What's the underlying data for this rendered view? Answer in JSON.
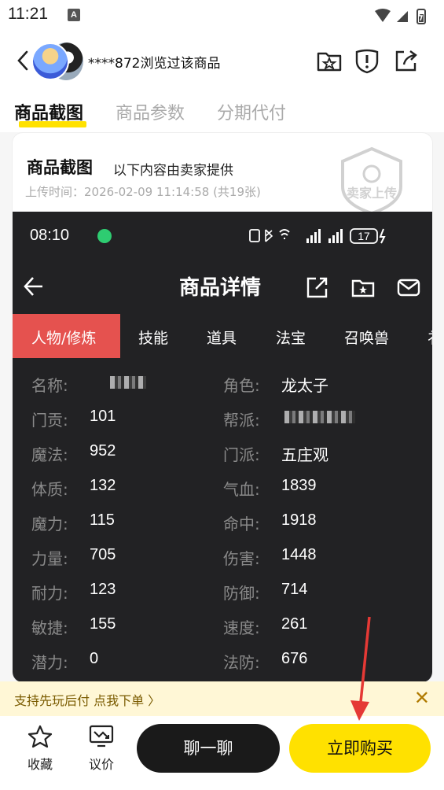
{
  "status": {
    "time": "11:21",
    "app_icon": "A"
  },
  "header": {
    "browse_text": "****872浏览过该商品"
  },
  "tabs": [
    {
      "label": "商品截图"
    },
    {
      "label": "商品参数"
    },
    {
      "label": "分期代付"
    }
  ],
  "card": {
    "title": "商品截图",
    "subtitle": "以下内容由卖家提供",
    "meta": "上传时间：2026-02-09 11:14:58 (共19张)",
    "stamp_text": "卖家上传"
  },
  "screenshot": {
    "time": "08:10",
    "battery": "17",
    "title": "商品详情",
    "tabs": [
      "人物/修炼",
      "技能",
      "道具",
      "法宝",
      "召唤兽",
      "衤"
    ],
    "left_attrs": [
      {
        "key": "名称:",
        "value": ""
      },
      {
        "key": "门贡:",
        "value": "101"
      },
      {
        "key": "魔法:",
        "value": "952"
      },
      {
        "key": "体质:",
        "value": "132"
      },
      {
        "key": "魔力:",
        "value": "115"
      },
      {
        "key": "力量:",
        "value": "705"
      },
      {
        "key": "耐力:",
        "value": "123"
      },
      {
        "key": "敏捷:",
        "value": "155"
      },
      {
        "key": "潜力:",
        "value": "0"
      }
    ],
    "right_attrs": [
      {
        "key": "角色:",
        "value": "龙太子"
      },
      {
        "key": "帮派:",
        "value": ""
      },
      {
        "key": "门派:",
        "value": "五庄观"
      },
      {
        "key": "气血:",
        "value": "1839"
      },
      {
        "key": "命中:",
        "value": "1918"
      },
      {
        "key": "伤害:",
        "value": "1448"
      },
      {
        "key": "防御:",
        "value": "714"
      },
      {
        "key": "速度:",
        "value": "261"
      },
      {
        "key": "法防:",
        "value": "676"
      }
    ]
  },
  "promo": {
    "text": "支持先玩后付 点我下单  〉",
    "close": "✕"
  },
  "bottom": {
    "favorite": "收藏",
    "bargain": "议价",
    "chat": "聊一聊",
    "buy": "立即购买"
  },
  "colors": {
    "accent_yellow": "#ffe100",
    "active_tab_red": "#e5524f",
    "annotation_arrow": "#e53935"
  }
}
